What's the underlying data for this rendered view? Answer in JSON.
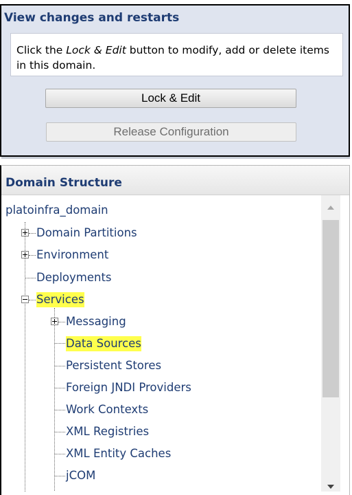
{
  "change_center": {
    "title": "View changes and restarts",
    "instructions_prefix": "Click the ",
    "instructions_emphasis": "Lock & Edit",
    "instructions_suffix": " button to modify, add or delete items in this domain.",
    "lock_edit_label": "Lock & Edit",
    "release_config_label": "Release Configuration"
  },
  "domain_structure": {
    "title": "Domain Structure",
    "root": "platoinfra_domain",
    "nodes": [
      {
        "label": "Domain Partitions",
        "toggle": "plus"
      },
      {
        "label": "Environment",
        "toggle": "plus"
      },
      {
        "label": "Deployments",
        "toggle": "none"
      },
      {
        "label": "Services",
        "toggle": "minus",
        "highlighted": true
      },
      {
        "label": "Messaging",
        "toggle": "plus"
      },
      {
        "label": "Data Sources",
        "toggle": "none",
        "highlighted": true
      },
      {
        "label": "Persistent Stores",
        "toggle": "none"
      },
      {
        "label": "Foreign JNDI Providers",
        "toggle": "none"
      },
      {
        "label": "Work Contexts",
        "toggle": "none"
      },
      {
        "label": "XML Registries",
        "toggle": "none"
      },
      {
        "label": "XML Entity Caches",
        "toggle": "none"
      },
      {
        "label": "jCOM",
        "toggle": "none"
      }
    ]
  },
  "colors": {
    "link": "#1e3c73",
    "highlight": "#ffff4d",
    "panel_bg": "#dfe4ef"
  },
  "icons": {
    "expand": "plus-box-icon",
    "collapse": "minus-box-icon",
    "scroll_up": "triangle-up-icon",
    "scroll_down": "triangle-down-icon"
  }
}
